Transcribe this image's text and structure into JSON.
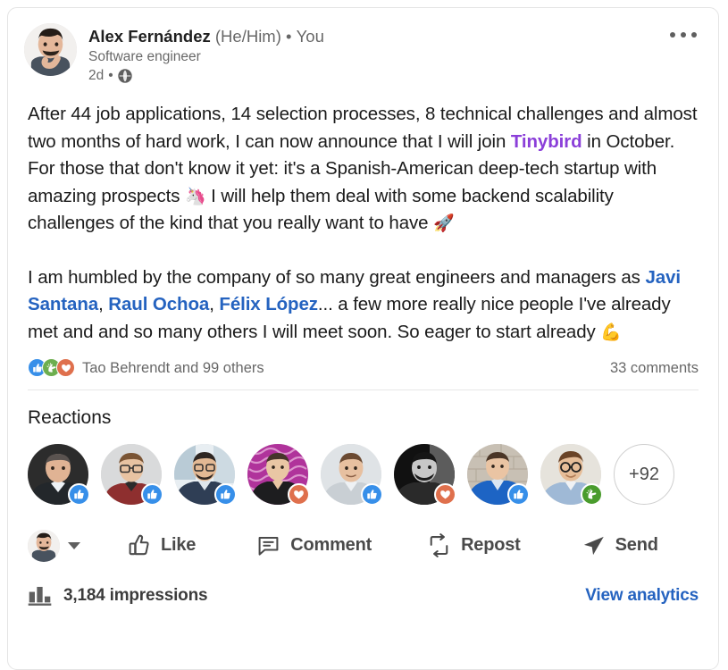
{
  "colors": {
    "brand_blue": "#2563c0",
    "mention_blue": "#2563c0",
    "company_purple": "#8b3fd9",
    "like_blue": "#378fe9",
    "celebrate_green": "#6dae4f",
    "love_red": "#df704d",
    "text_primary": "#1b1b1b",
    "text_secondary": "#00000099",
    "card_border": "#e4e4e4"
  },
  "header": {
    "author_name": "Alex Fernández",
    "pronouns": "(He/Him)",
    "separator": "•",
    "you_label": "You",
    "headline": "Software engineer",
    "timestamp": "2d",
    "visibility_icon": "globe-icon",
    "more_icon": "more-options-icon"
  },
  "post": {
    "paragraph1": {
      "part1": "After 44 job applications, 14 selection processes, 8 technical challenges and almost two months of hard work, I can now announce that I will join ",
      "company": "Tinybird",
      "part2": " in October. For those that don't know it yet: it's a Spanish-American deep-tech startup with amazing prospects ",
      "emoji1": "🦄",
      "part3": " I will help them deal with some backend scalability challenges of the kind that you really want to have ",
      "emoji2": "🚀"
    },
    "paragraph2": {
      "part1": "I am humbled by the company of so many great engineers and managers as ",
      "mention1": "Javi Santana",
      "sep1": ", ",
      "mention2": "Raul Ochoa",
      "sep2": ", ",
      "mention3": "Félix López",
      "part2": "... a few more really nice people I've already met and and so many others I will meet soon. So eager to start already ",
      "emoji1": "💪"
    }
  },
  "social_proof": {
    "reaction_icons": [
      "like-reaction-icon",
      "celebrate-reaction-icon",
      "love-reaction-icon"
    ],
    "names_text": "Tao Behrendt and 99 others",
    "comments_text": "33 comments"
  },
  "reactions_section": {
    "title": "Reactions",
    "reactors": [
      {
        "badge": "like"
      },
      {
        "badge": "like"
      },
      {
        "badge": "like"
      },
      {
        "badge": "love"
      },
      {
        "badge": "like"
      },
      {
        "badge": "love"
      },
      {
        "badge": "like"
      },
      {
        "badge": "celebrate"
      }
    ],
    "overflow_label": "+92"
  },
  "actions": {
    "like_label": "Like",
    "comment_label": "Comment",
    "repost_label": "Repost",
    "send_label": "Send",
    "like_icon": "thumbs-up-icon",
    "comment_icon": "speech-bubble-icon",
    "repost_icon": "repost-arrows-icon",
    "send_icon": "paper-plane-icon",
    "chevron_icon": "chevron-down-icon"
  },
  "footer": {
    "impressions_text": "3,184 impressions",
    "impressions_icon": "bar-chart-icon",
    "view_analytics_label": "View analytics"
  }
}
